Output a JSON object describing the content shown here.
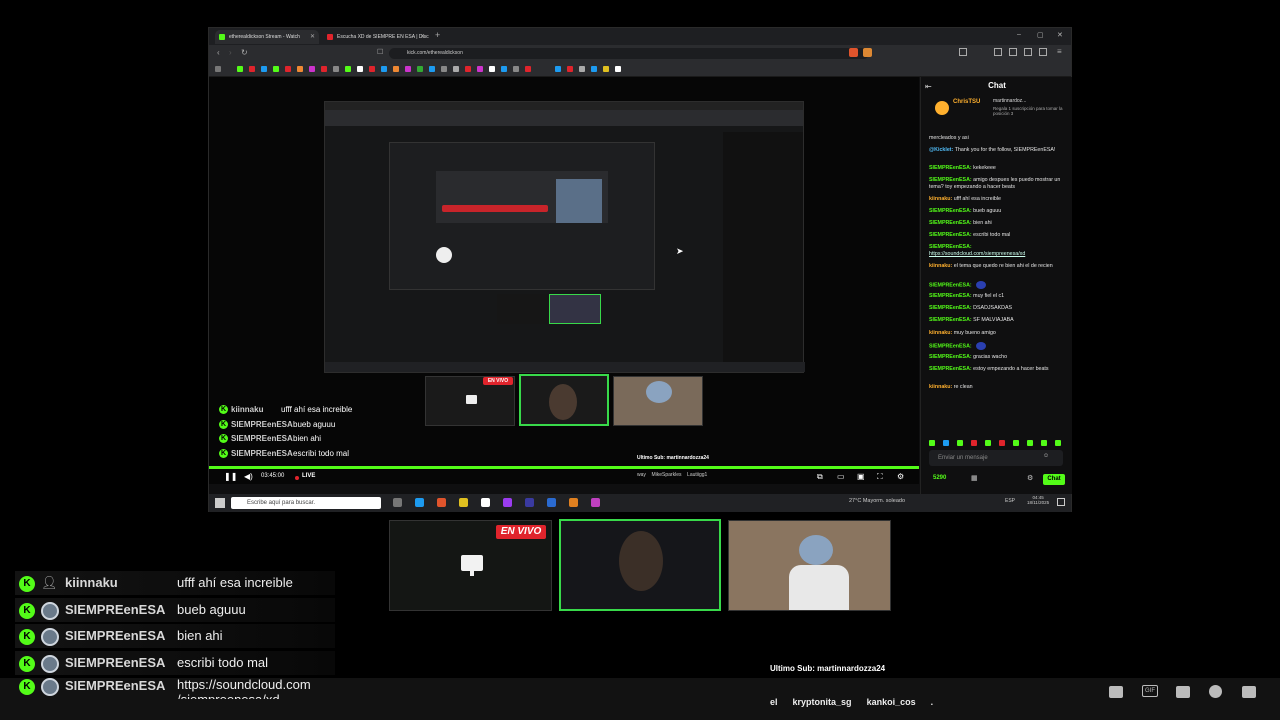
{
  "browser": {
    "tabs": [
      {
        "title": "etherealdickson Stream - Watch",
        "color": "#53fc18"
      },
      {
        "title": "Escucha XD de SIEMPRE EN ESA | Disc",
        "color": "#e0242c"
      }
    ],
    "url": "kick.com/etherealdickson"
  },
  "stream": {
    "live_badge": "EN VIVO",
    "time": "03:45:00",
    "live_label": "LIVE",
    "sub_text": "Ultimo Sub: martinnardozza24",
    "ticker": [
      "way",
      "MikeSparkles",
      "Lautiigg1"
    ],
    "overlay_chat": [
      {
        "user": "kiinnaku",
        "text": "ufff ahí esa increible"
      },
      {
        "user": "SIEMPREenESA",
        "text": "bueb aguuu"
      },
      {
        "user": "SIEMPREenESA",
        "text": "bien ahi"
      },
      {
        "user": "SIEMPREenESA",
        "text": "escribi todo mal"
      },
      {
        "user": "SIEMPREenESA",
        "text": "https://soundcloud.com /siempreenesa/xd"
      }
    ]
  },
  "chat": {
    "title": "Chat",
    "pinned_user": "ChrisTSU",
    "pinned_other": "martinnardoz...",
    "pinned_note": "Regala 1 suscripción para tomar la posición 3",
    "first_line": "mercleados y asi",
    "messages": [
      {
        "user": "@Kicklet:",
        "text": "Thank you for the follow, SIEMPREenESA!",
        "kind": "bot"
      },
      {
        "user": "SIEMPREenESA:",
        "text": "kekekeee",
        "kind": "u"
      },
      {
        "user": "SIEMPREenESA:",
        "text": "amigo despues les puedo mostrar un tema? toy empezando a hacer beats",
        "kind": "u"
      },
      {
        "user": "kiinnaku:",
        "text": "ufff ahí esa increible",
        "kind": "o"
      },
      {
        "user": "SIEMPREenESA:",
        "text": "bueb aguuu",
        "kind": "u"
      },
      {
        "user": "SIEMPREenESA:",
        "text": "bien ahi",
        "kind": "u"
      },
      {
        "user": "SIEMPREenESA:",
        "text": "escribi todo mal",
        "kind": "u"
      },
      {
        "user": "SIEMPREenESA:",
        "text": "https://soundcloud.com/siempreenesa/xd",
        "kind": "link"
      },
      {
        "user": "kiinnaku:",
        "text": "el tema que quedo re bien ahi el de recien",
        "kind": "o"
      },
      {
        "user": "SIEMPREenESA:",
        "text": "",
        "kind": "emote"
      },
      {
        "user": "SIEMPREenESA:",
        "text": "muy fiel el c1",
        "kind": "u"
      },
      {
        "user": "SIEMPREenESA:",
        "text": "DSADJSAKDAS",
        "kind": "u"
      },
      {
        "user": "SIEMPREenESA:",
        "text": "SF MALVIAJABA",
        "kind": "u"
      },
      {
        "user": "kiinnaku:",
        "text": "muy bueno amigo",
        "kind": "o"
      },
      {
        "user": "SIEMPREenESA:",
        "text": "",
        "kind": "emote"
      },
      {
        "user": "SIEMPREenESA:",
        "text": "gracias wacho",
        "kind": "u"
      },
      {
        "user": "SIEMPREenESA:",
        "text": "estoy empezando a hacer beats",
        "kind": "u"
      },
      {
        "user": "kiinnaku:",
        "text": "re clean",
        "kind": "o"
      }
    ],
    "input_placeholder": "Enviar un mensaje",
    "points": "5290",
    "send_label": "Chat"
  },
  "taskbar": {
    "search_placeholder": "Escribe aquí para buscar.",
    "weather": "27°C  Mayorm. soleado",
    "lang": "ESP",
    "clock_time": "04:45",
    "clock_date": "18/11/2025"
  },
  "bottom_overlay": {
    "sub_text": "Ultimo Sub: martinnardozza24",
    "ticker": [
      "el",
      "kryptonita_sg",
      "kankoi_cos",
      "."
    ],
    "rows": [
      {
        "user": "kiinnaku",
        "text": "ufff ahí esa increible"
      },
      {
        "user": "SIEMPREenESA",
        "text": "bueb aguuu"
      },
      {
        "user": "SIEMPREenESA",
        "text": "bien ahi"
      },
      {
        "user": "SIEMPREenESA",
        "text": "escribi todo mal"
      },
      {
        "user": "SIEMPREenESA",
        "text": "https://soundcloud.com /siempreenesa/xd"
      }
    ],
    "live_badge": "EN VIVO"
  },
  "colors": {
    "kick_green": "#53fc18",
    "live_red": "#e0242c"
  }
}
